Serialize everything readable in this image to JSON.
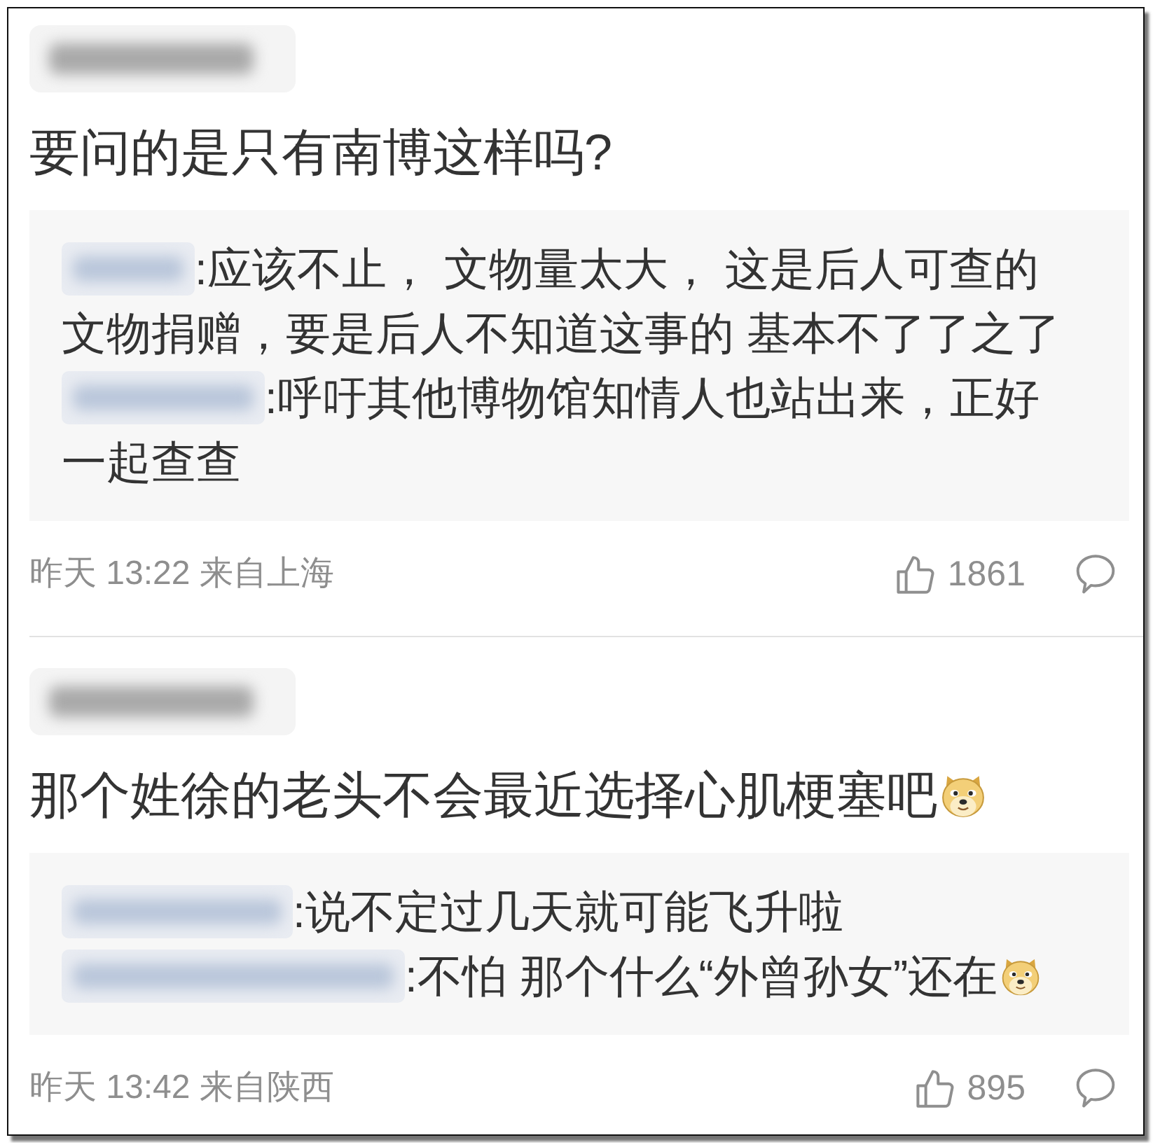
{
  "comments": [
    {
      "text": "要问的是只有南博这样吗?",
      "trailing_emoji": false,
      "replies": [
        {
          "lines": [
            ":应该不止， 文物量太大， 这是后人可查的",
            "文物捐赠，要是后人不知道这事的 基本不了了之了"
          ],
          "trailing_emoji": false
        },
        {
          "lines": [
            ":呼吁其他博物馆知情人也站出来，正好",
            "一起查查"
          ],
          "trailing_emoji": false
        }
      ],
      "meta": "昨天 13:22 来自上海",
      "likes": "1861"
    },
    {
      "text": "那个姓徐的老头不会最近选择心肌梗塞吧",
      "trailing_emoji": true,
      "replies": [
        {
          "lines": [
            ":说不定过几天就可能飞升啦"
          ],
          "trailing_emoji": false
        },
        {
          "lines": [
            ":不怕 那个什么“外曾孙女”还在"
          ],
          "trailing_emoji": true
        }
      ],
      "meta": "昨天 13:42 来自陕西",
      "likes": "895"
    }
  ]
}
